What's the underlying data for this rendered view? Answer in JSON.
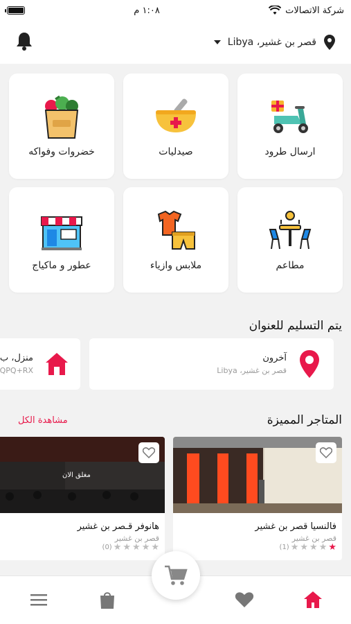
{
  "status_bar": {
    "carrier": "شركة الاتصالات",
    "time": "١:٠٨ م"
  },
  "location": {
    "text": "قصر بن غشير، Libya",
    "pin_icon": "location-pin-icon",
    "bell_icon": "bell-icon"
  },
  "categories": [
    {
      "label": "ارسال طرود",
      "icon": "delivery-scooter-icon"
    },
    {
      "label": "صيدليات",
      "icon": "pharmacy-bowl-icon"
    },
    {
      "label": "خضروات وفواكه",
      "icon": "grocery-bag-icon"
    },
    {
      "label": "مطاعم",
      "icon": "restaurant-table-icon"
    },
    {
      "label": "ملابس وازياء",
      "icon": "clothes-icon"
    },
    {
      "label": "عطور و ماكياج",
      "icon": "storefront-icon"
    }
  ],
  "delivery": {
    "title": "يتم التسليم للعنوان",
    "addresses": [
      {
        "name": "آخرون",
        "detail": "قصر بن غشير، Libya",
        "icon": "map-pin-icon"
      },
      {
        "name": "منزل، ب",
        "detail": "QPQ+RX",
        "icon": "home-icon"
      }
    ]
  },
  "featured": {
    "title": "المتاجر المميزة",
    "view_all": "مشاهدة الكل",
    "stores": [
      {
        "name": "فالنسيا قصر بن غشير",
        "area": "قصر بن غشير",
        "rating": 1,
        "count": "(1)",
        "status": ""
      },
      {
        "name": "هانوفر قـصر بن غشير",
        "area": "قصر بن غشير",
        "rating": 0,
        "count": "(0)",
        "status": "مغلق الان"
      }
    ]
  },
  "tabbar": {
    "items": [
      "home-icon",
      "heart-icon",
      "cart-icon",
      "bag-icon",
      "menu-icon"
    ]
  },
  "colors": {
    "accent": "#e8194b",
    "background": "#f2f2f2",
    "icon_gray": "#777777"
  }
}
